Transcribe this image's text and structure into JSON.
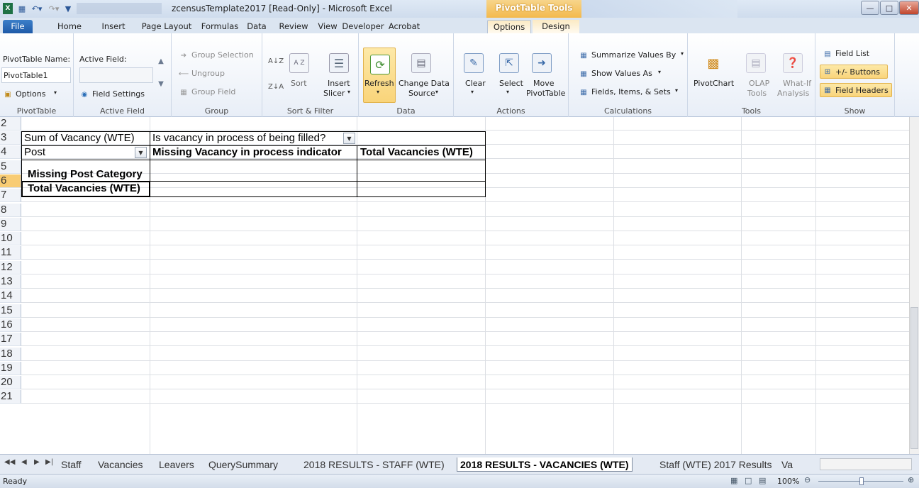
{
  "window": {
    "title": "zcensusTemplate2017  [Read-Only]  -  Microsoft Excel",
    "context_tool": "PivotTable Tools"
  },
  "tabs": [
    "File",
    "Home",
    "Insert",
    "Page Layout",
    "Formulas",
    "Data",
    "Review",
    "View",
    "Developer",
    "Acrobat",
    "Options",
    "Design"
  ],
  "ribbon": {
    "pivottable": {
      "name_label": "PivotTable Name:",
      "name_value": "PivotTable1",
      "options": "Options",
      "group": "PivotTable"
    },
    "active_field": {
      "label": "Active Field:",
      "settings": "Field Settings",
      "group": "Active Field"
    },
    "group": {
      "selection": "Group Selection",
      "ungroup": "Ungroup",
      "field": "Group Field",
      "group": "Group"
    },
    "sort_filter": {
      "sort": "Sort",
      "insert": "Insert",
      "slicer": "Slicer",
      "group": "Sort & Filter"
    },
    "data": {
      "refresh": "Refresh",
      "change1": "Change Data",
      "change2": "Source",
      "group": "Data"
    },
    "actions": {
      "clear": "Clear",
      "select": "Select",
      "move1": "Move",
      "move2": "PivotTable",
      "group": "Actions"
    },
    "calculations": {
      "summarize": "Summarize Values By",
      "show_as": "Show Values As",
      "fields": "Fields, Items, & Sets",
      "group": "Calculations"
    },
    "tools": {
      "pivotchart": "PivotChart",
      "olap1": "OLAP",
      "olap2": "Tools",
      "whatif1": "What-If",
      "whatif2": "Analysis",
      "group": "Tools"
    },
    "show": {
      "field_list": "Field List",
      "buttons": "+/- Buttons",
      "headers": "Field Headers",
      "group": "Show"
    }
  },
  "sheet": {
    "row_numbers": [
      "2",
      "3",
      "4",
      "5",
      "6",
      "7",
      "8",
      "9",
      "10",
      "11",
      "12",
      "13",
      "14",
      "15",
      "16",
      "17",
      "18",
      "19",
      "20",
      "21"
    ],
    "pivot": {
      "value_field": "Sum of Vacancy (WTE)",
      "column_field": "Is vacancy in process of being filled?",
      "row_field": "Post",
      "col_header_1": "Missing Vacancy in process indicator",
      "col_header_2": "Total Vacancies (WTE)",
      "row_item": "Missing Post Category",
      "grand_total": "Total Vacancies (WTE)"
    }
  },
  "sheet_tabs": [
    "Staff",
    "Vacancies",
    "Leavers",
    "QuerySummary",
    "2018 RESULTS - STAFF (WTE)",
    "2018 RESULTS - VACANCIES (WTE)",
    "Staff (WTE) 2017 Results",
    "Va"
  ],
  "status": {
    "ready": "Ready",
    "zoom": "100%"
  }
}
